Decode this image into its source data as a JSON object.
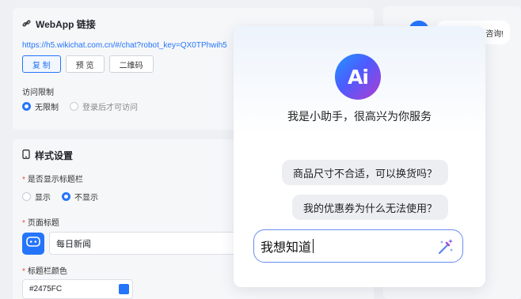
{
  "webapp": {
    "title": "WebApp 链接",
    "url": "https://h5.wikichat.com.cn/#/chat?robot_key=QX0TPhwih5",
    "buttons": {
      "copy": "复 制",
      "preview": "预 览",
      "qrcode": "二维码"
    },
    "access_label": "访问限制",
    "access_options": {
      "unlimited": "无限制",
      "login": "登录后才可访问"
    }
  },
  "style": {
    "title": "样式设置",
    "show_titlebar_label": "是否显示标题栏",
    "show_options": {
      "show": "显示",
      "hide": "不显示"
    },
    "page_title_label": "页面标题",
    "page_title_value": "每日新闻",
    "titlebar_color_label": "标题栏颜色",
    "titlebar_color_value": "#2475FC"
  },
  "preview": {
    "bubble_text": "咨询!"
  },
  "assistant": {
    "logo_text": "Ai",
    "greeting": "我是小助手，很高兴为你服务",
    "questions": [
      "商品尺寸不合适，可以换货吗？",
      "我的优惠券为什么无法使用？"
    ],
    "input_value": "我想知道"
  },
  "colors": {
    "accent": "#2475FC",
    "required": "#F04A4A",
    "logo_gradient": [
      "#2196FF",
      "#4D5BFF",
      "#B23CCF"
    ]
  },
  "icons": [
    "link-icon",
    "phone-icon",
    "robot-face-icon",
    "magic-wand-icon"
  ]
}
